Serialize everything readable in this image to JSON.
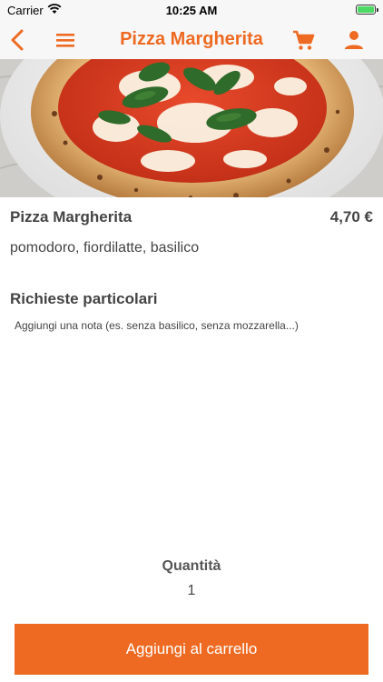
{
  "status_bar": {
    "carrier": "Carrier",
    "time": "10:25 AM",
    "icons": [
      "wifi-icon",
      "battery-charging-icon"
    ]
  },
  "nav": {
    "title": "Pizza Margherita",
    "icons": [
      "back-chevron-icon",
      "menu-icon",
      "cart-icon",
      "user-icon"
    ],
    "accent_color": "#ee6a22"
  },
  "product": {
    "image": "pizza-margherita-photo",
    "name": "Pizza Margherita",
    "price": "4,70 €",
    "description": "pomodoro, fiordilatte, basilico"
  },
  "notes": {
    "title": "Richieste particolari",
    "placeholder": "Aggiungi una nota (es. senza basilico, senza mozzarella...)"
  },
  "quantity": {
    "label": "Quantità",
    "value": "1"
  },
  "actions": {
    "add_to_cart": "Aggiungi al carrello"
  }
}
